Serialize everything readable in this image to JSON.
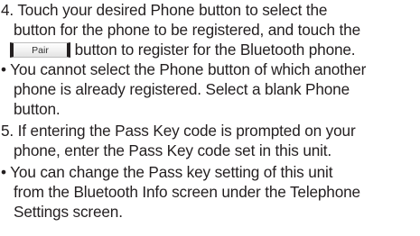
{
  "step4": {
    "line1": "4. Touch your desired Phone button to select the",
    "line2": "button for the phone to be registered, and touch the",
    "pair_label": "Pair",
    "line3_rest": "button to register for the Bluetooth phone."
  },
  "note1": {
    "line1": "• You cannot select the Phone button of which another",
    "line2": "phone is already registered. Select a blank Phone",
    "line3": "button."
  },
  "step5": {
    "line1": "5. If entering the Pass Key code is prompted on your",
    "line2": "phone, enter the Pass Key code set in this unit."
  },
  "note2": {
    "line1": "• You can change the Pass key setting of this unit",
    "line2": "from the Bluetooth Info screen under the Telephone",
    "line3": "Settings screen."
  }
}
